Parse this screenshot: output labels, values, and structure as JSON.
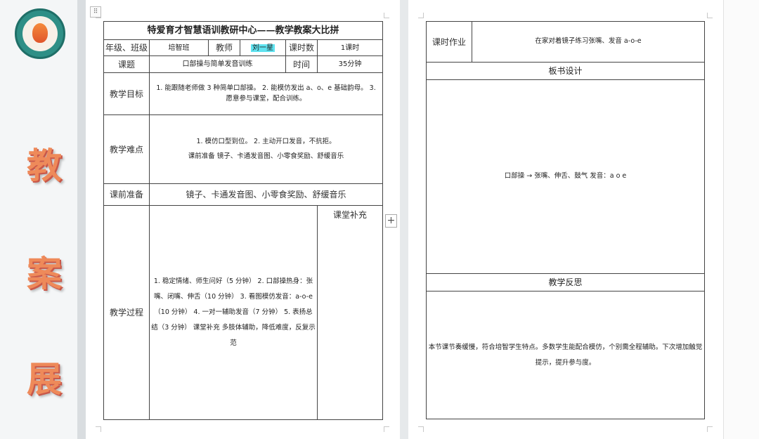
{
  "sidebar": {
    "big_chars": [
      "教",
      "案",
      "展"
    ]
  },
  "plan": {
    "title": "特爱育才智慧语训教研中心——教学教案大比拼",
    "grade_label": "年级、班级",
    "grade_value": "培智班",
    "teacher_label": "教师",
    "teacher_value": "刘一星",
    "hours_label": "课时数",
    "hours_value": "1课时",
    "topic_label": "课题",
    "topic_value": "口部操与简单发音训练",
    "time_label": "时间",
    "time_value": "35分钟",
    "goals_label": "教学目标",
    "goals_value": "1. 能跟随老师做 3 种简单口部操。 2. 能模仿发出 a、o、e 基础韵母。 3. 愿意参与课堂，配合训练。",
    "difficulty_label": "教学难点",
    "difficulty_line1": "1. 模仿口型到位。 2. 主动开口发音，不抗拒。",
    "difficulty_line2": "课前准备 镜子、卡通发音图、小零食奖励、舒缓音乐",
    "prep_label": "课前准备",
    "prep_value": "镜子、卡通发音图、小零食奖励、舒缓音乐",
    "process_label": "教学过程",
    "process_value": "1. 稳定情绪、师生问好（5 分钟） 2. 口部操热身：张嘴、闭嘴、伸舌（10 分钟） 3. 看图模仿发音：a-o-e（10 分钟） 4. 一对一辅助发音（7 分钟） 5. 表扬总结（3 分钟） 课堂补充 多肢体辅助，降低难度，反复示范",
    "supplement_label": "课堂补充"
  },
  "page2": {
    "homework_label": "课时作业",
    "homework_value": "在家对着镜子练习张嘴、发音 a-o-e",
    "board_label": "板书设计",
    "board_value": "口部操 → 张嘴、伸舌、鼓气 发音：a o e",
    "reflection_label": "教学反思",
    "reflection_value": "本节课节奏缓慢，符合培智学生特点。多数学生能配合模仿，个别需全程辅助。下次增加触觉提示，提升参与度。"
  },
  "colors": {
    "highlight": "#5fe3f0",
    "accent_char": "#ee8a5a",
    "logo_teal": "#2f8f86"
  }
}
